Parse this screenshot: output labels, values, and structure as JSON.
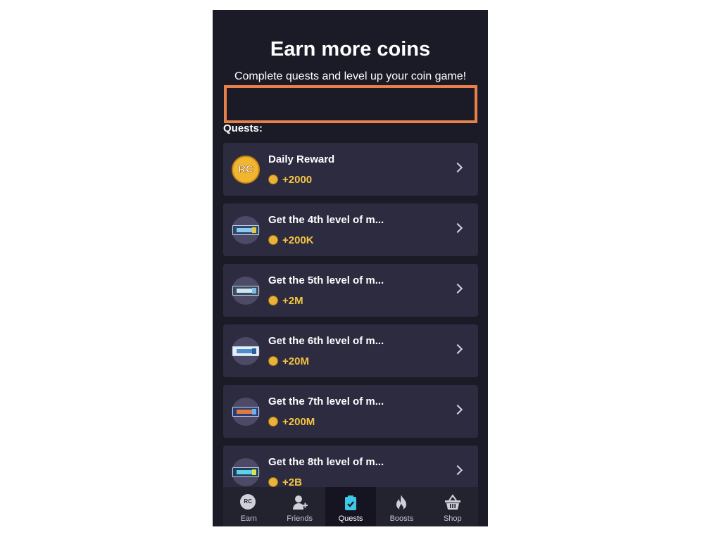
{
  "header": {
    "title": "Earn more coins",
    "subtitle": "Complete quests and level up your coin game!"
  },
  "quests_label": "Quests:",
  "quests": [
    {
      "name": "Daily Reward",
      "reward": "+2000",
      "icon": "rc-coin-icon"
    },
    {
      "name": "Get the 4th level of m...",
      "reward": "+200K",
      "icon": "card-icon"
    },
    {
      "name": "Get the 5th level of m...",
      "reward": "+2M",
      "icon": "card-icon"
    },
    {
      "name": "Get the 6th level of m...",
      "reward": "+20M",
      "icon": "card-icon"
    },
    {
      "name": "Get the 7th level of m...",
      "reward": "+200M",
      "icon": "card-icon"
    },
    {
      "name": "Get the 8th level of m...",
      "reward": "+2B",
      "icon": "card-icon"
    }
  ],
  "nav": {
    "items": [
      {
        "label": "Earn",
        "icon": "rc-icon",
        "active": false,
        "icon_text": "RC"
      },
      {
        "label": "Friends",
        "icon": "add-friend-icon",
        "active": false
      },
      {
        "label": "Quests",
        "icon": "clipboard-check-icon",
        "active": true
      },
      {
        "label": "Boosts",
        "icon": "flame-icon",
        "active": false
      },
      {
        "label": "Shop",
        "icon": "basket-icon",
        "active": false
      }
    ]
  },
  "colors": {
    "background": "#1b1b27",
    "card": "#2c2b40",
    "reward": "#f5c542",
    "highlight": "#e8804a"
  }
}
